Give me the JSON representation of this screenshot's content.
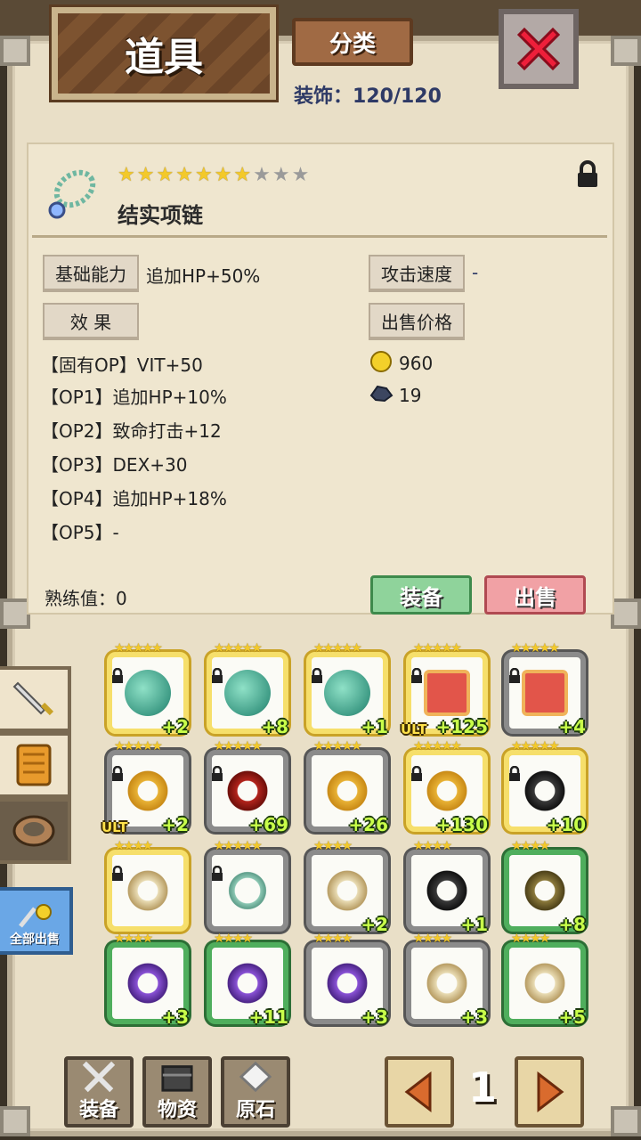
{
  "header": {
    "title": "道具",
    "category_label": "分类",
    "decor_label": "装饰：",
    "decor_count": "120/120"
  },
  "detail": {
    "stars_on": 7,
    "stars_total": 10,
    "name": "结实项链",
    "base_ability_label": "基础能力",
    "base_ability_value": "追加HP+50%",
    "attack_speed_label": "攻击速度",
    "attack_speed_value": "-",
    "effect_label": "效 果",
    "sell_price_label": "出售价格",
    "sell_gold": "960",
    "sell_ore": "19",
    "options": [
      "【固有OP】VIT+50",
      "【OP1】追加HP+10%",
      "【OP2】致命打击+12",
      "【OP3】DEX+30",
      "【OP4】追加HP+18%",
      "【OP5】-"
    ],
    "mastery_label": "熟练值：",
    "mastery_value": "0",
    "equip_button": "装备",
    "sell_button": "出售"
  },
  "side": {
    "sell_all_label": "全部出售"
  },
  "grid": [
    {
      "icon": "orb",
      "frame": "gold",
      "stars": "★★★★★",
      "plus": "+2",
      "ult": "",
      "locked": true
    },
    {
      "icon": "orb",
      "frame": "gold",
      "stars": "★★★★★",
      "plus": "+8",
      "ult": "",
      "locked": true
    },
    {
      "icon": "orb",
      "frame": "gold",
      "stars": "★★★★★",
      "plus": "+1",
      "ult": "",
      "locked": true
    },
    {
      "icon": "door",
      "frame": "gold",
      "stars": "★★★★★",
      "plus": "+125",
      "ult": "ULT",
      "locked": true
    },
    {
      "icon": "door",
      "frame": "silver",
      "stars": "★★★★★",
      "plus": "+4",
      "ult": "",
      "locked": true
    },
    {
      "icon": "ring-gold",
      "frame": "silver",
      "stars": "★★★★★",
      "plus": "+2",
      "ult": "ULT",
      "locked": true
    },
    {
      "icon": "ring-red",
      "frame": "silver",
      "stars": "★★★★★",
      "plus": "+69",
      "ult": "",
      "locked": true
    },
    {
      "icon": "ring-gold",
      "frame": "silver",
      "stars": "★★★★★",
      "plus": "+26",
      "ult": "",
      "locked": false
    },
    {
      "icon": "ring-gold",
      "frame": "gold",
      "stars": "★★★★★",
      "plus": "+130",
      "ult": "",
      "locked": true
    },
    {
      "icon": "ring-black",
      "frame": "gold",
      "stars": "★★★★★",
      "plus": "+10",
      "ult": "",
      "locked": true
    },
    {
      "icon": "ring-cream",
      "frame": "gold",
      "stars": "★★★★",
      "plus": "",
      "ult": "",
      "locked": true
    },
    {
      "icon": "neck",
      "frame": "silver",
      "stars": "★★★★★",
      "plus": "",
      "ult": "",
      "locked": true
    },
    {
      "icon": "ring-cream",
      "frame": "silver",
      "stars": "★★★★",
      "plus": "+2",
      "ult": "",
      "locked": false
    },
    {
      "icon": "ring-black",
      "frame": "silver",
      "stars": "★★★★",
      "plus": "+1",
      "ult": "",
      "locked": false
    },
    {
      "icon": "ring-olive",
      "frame": "green",
      "stars": "★★★★",
      "plus": "+8",
      "ult": "",
      "locked": false
    },
    {
      "icon": "ring-purple",
      "frame": "green",
      "stars": "★★★★",
      "plus": "+3",
      "ult": "",
      "locked": false
    },
    {
      "icon": "ring-purple",
      "frame": "green",
      "stars": "★★★★",
      "plus": "+11",
      "ult": "",
      "locked": false
    },
    {
      "icon": "ring-purple",
      "frame": "silver",
      "stars": "★★★★",
      "plus": "+3",
      "ult": "",
      "locked": false
    },
    {
      "icon": "ring-cream",
      "frame": "silver",
      "stars": "★★★★",
      "plus": "+3",
      "ult": "",
      "locked": false
    },
    {
      "icon": "ring-cream",
      "frame": "green",
      "stars": "★★★★",
      "plus": "+5",
      "ult": "",
      "locked": false
    }
  ],
  "bottom": {
    "equip_tab": "装备",
    "material_tab": "物资",
    "ore_tab": "原石",
    "page": "1"
  }
}
